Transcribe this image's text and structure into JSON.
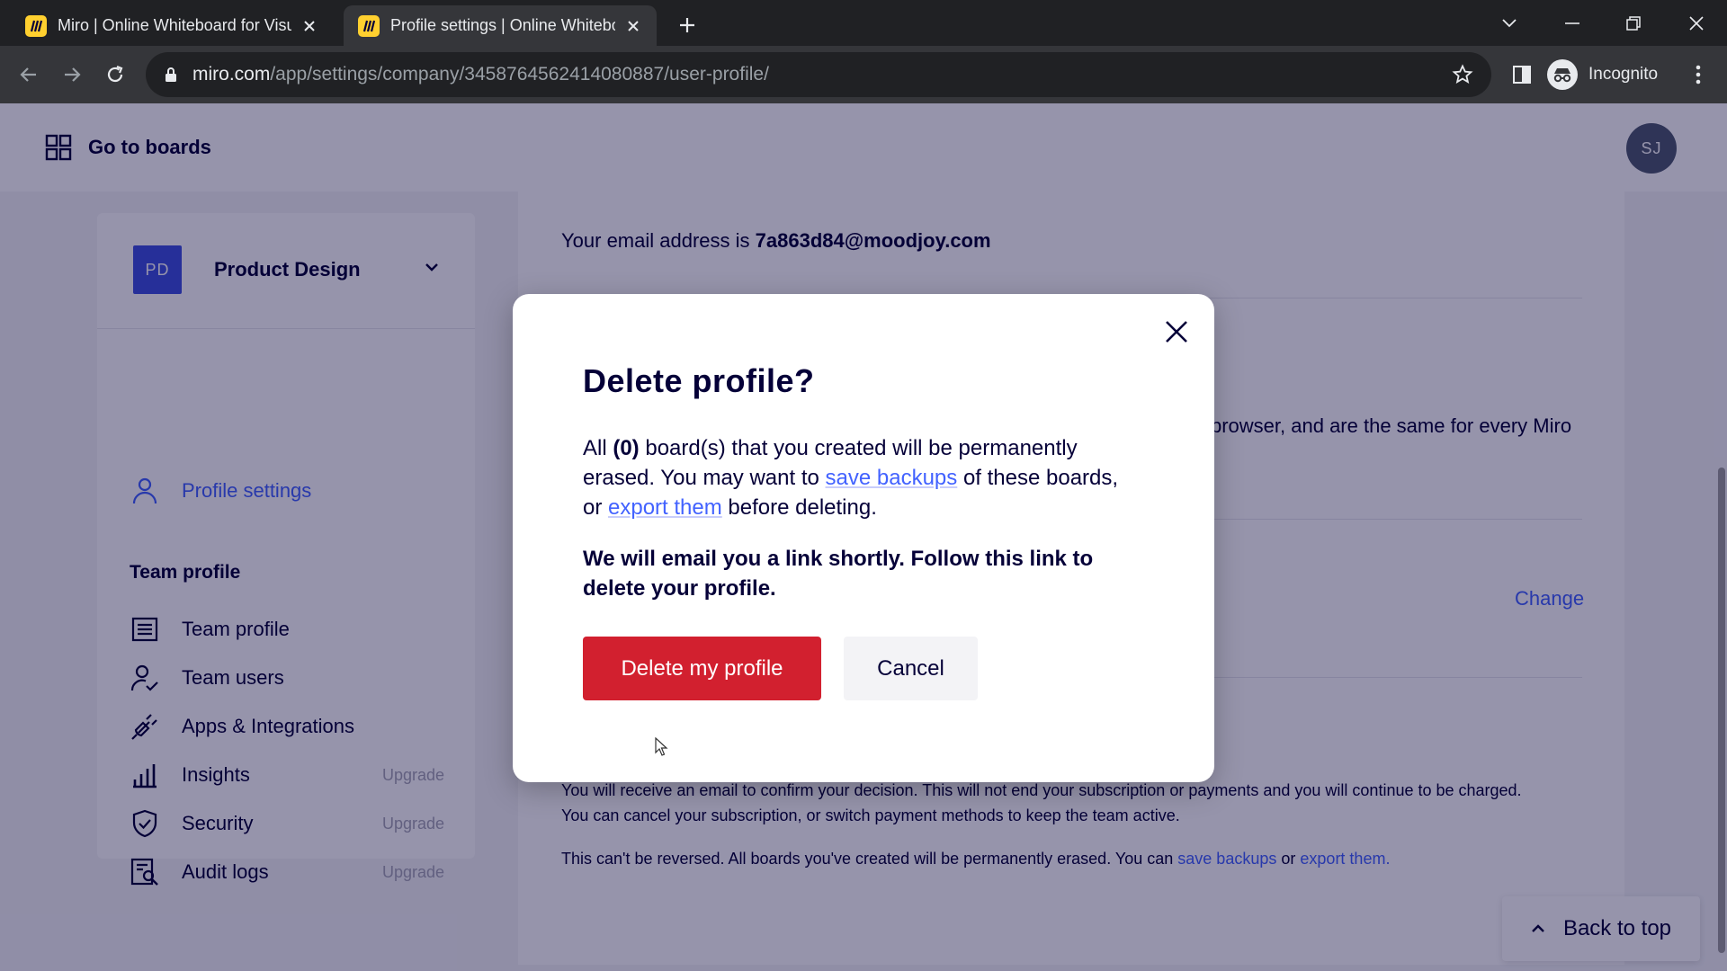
{
  "browser": {
    "tabs": [
      {
        "title": "Miro | Online Whiteboard for Visual Collaboration",
        "active": false
      },
      {
        "title": "Profile settings | Online Whiteboard for Visual Collaboration",
        "active": true
      }
    ],
    "url_host": "miro.com",
    "url_path": "/app/settings/company/3458764562414080887/user-profile/",
    "profile_label": "Incognito"
  },
  "header": {
    "go_to_boards": "Go to boards",
    "avatar_initials": "SJ"
  },
  "sidebar": {
    "org_badge": "PD",
    "org_name": "Product Design",
    "profile_settings": "Profile settings",
    "team_section": "Team profile",
    "items": [
      {
        "label": "Team profile",
        "upgrade": ""
      },
      {
        "label": "Team users",
        "upgrade": ""
      },
      {
        "label": "Apps & Integrations",
        "upgrade": ""
      },
      {
        "label": "Insights",
        "upgrade": "Upgrade"
      },
      {
        "label": "Security",
        "upgrade": "Upgrade"
      },
      {
        "label": "Audit logs",
        "upgrade": "Upgrade"
      }
    ]
  },
  "content": {
    "email_prefix": "Your email address is",
    "email": "7a863d84@moodjoy.com",
    "partial_text": "browser, and are the same for every Miro",
    "change_link": "Change",
    "confirm_text_1": "You will receive an email to confirm your decision. This will not end your subscription or payments and you will continue to be charged.",
    "confirm_text_2": "You can cancel your subscription, or switch payment methods to keep the team active.",
    "reversal_text": "This can't be reversed. All boards you've created will be permanently erased. You can",
    "save_backups_link": "save backups",
    "or_text": "or",
    "export_link": "export them."
  },
  "dialog": {
    "title": "Delete profile?",
    "body_1": "All",
    "board_count": "(0)",
    "body_2": "board(s) that you created will be permanently erased. You may want to",
    "save_backups": "save backups",
    "body_3": "of these boards, or",
    "export_them": "export them",
    "body_4": "before deleting.",
    "notice": "We will email you a link shortly. Follow this link to delete your profile.",
    "delete_button": "Delete my profile",
    "cancel_button": "Cancel"
  },
  "back_to_top": "Back to top",
  "colors": {
    "accent": "#4262ff",
    "danger": "#d2202f",
    "org_badge": "#3f51e0"
  }
}
